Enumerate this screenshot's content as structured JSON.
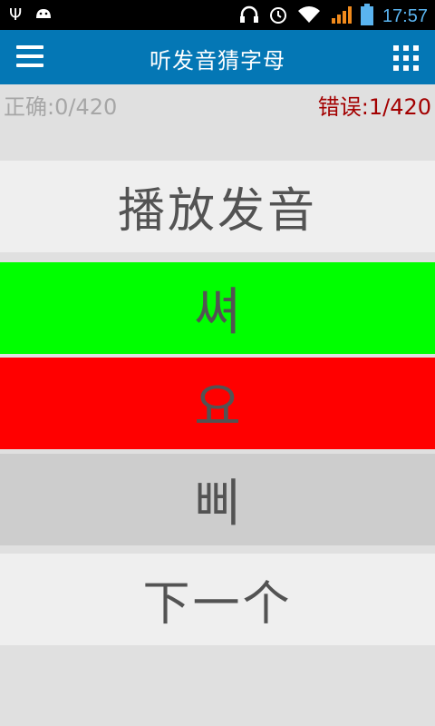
{
  "status_bar": {
    "time": "17:57",
    "icons_left": [
      "usb-icon",
      "android-icon"
    ],
    "icons_right": [
      "headset-icon",
      "alarm-icon",
      "wifi-icon",
      "signal-icon",
      "battery-icon"
    ]
  },
  "app_bar": {
    "title": "听发音猜字母",
    "menu_icon": "hamburger-menu-icon",
    "grid_icon": "grid-menu-icon",
    "color": "#0477b5"
  },
  "score": {
    "correct": "正确:0/420",
    "wrong": "错误:1/420"
  },
  "play_button": {
    "label": "播放发音"
  },
  "options": [
    {
      "label": "쎠",
      "state": "correct",
      "color": "#00ff00"
    },
    {
      "label": "요",
      "state": "wrong",
      "color": "#ff0000"
    },
    {
      "label": "삐",
      "state": "neutral",
      "color": "#cdcdcd"
    }
  ],
  "next_button": {
    "label": "下一个"
  }
}
